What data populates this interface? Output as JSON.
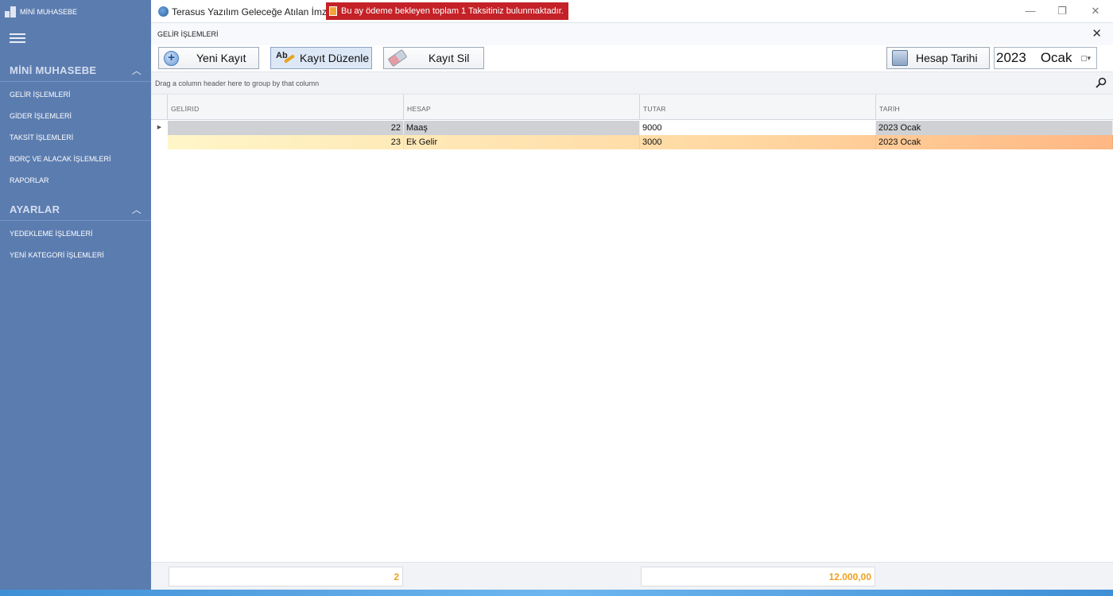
{
  "sidebar": {
    "app_title": "MİNİ MUHASEBE",
    "groups": [
      {
        "label": "MİNİ MUHASEBE",
        "items": [
          "GELİR İŞLEMLERİ",
          "GİDER İŞLEMLERİ",
          "TAKSİT İŞLEMLERİ",
          "BORÇ VE ALACAK İŞLEMLERİ",
          "RAPORLAR"
        ]
      },
      {
        "label": "AYARLAR",
        "items": [
          "YEDEKLEME İŞLEMLERİ",
          "YENİ KATEGORİ İŞLEMLERİ"
        ]
      }
    ]
  },
  "titlebar": {
    "title": "Terasus Yazılım Geleceğe Atılan İmza...",
    "alert": "Bu ay ödeme bekleyen toplam 1 Taksitiniz bulunmaktadır.",
    "minimize": "—",
    "restore": "❐",
    "close": "✕"
  },
  "panel": {
    "title": "GELİR İŞLEMLERİ",
    "close": "✕"
  },
  "toolbar": {
    "new_label": "Yeni Kayıt",
    "edit_label": "Kayıt Düzenle",
    "delete_label": "Kayıt Sil",
    "account_date_label": "Hesap Tarihi",
    "date_year": "2023",
    "date_month": "Ocak"
  },
  "grid": {
    "group_hint": "Drag a column header here to group by that column",
    "columns": [
      "GELİRID",
      "HESAP",
      "TUTAR",
      "TARİH"
    ],
    "rows": [
      {
        "id": "22",
        "hesap": "Maaş",
        "tutar": "9000",
        "tarih": "2023 Ocak"
      },
      {
        "id": "23",
        "hesap": "Ek Gelir",
        "tutar": "3000",
        "tarih": "2023 Ocak"
      }
    ],
    "footer_count": "2",
    "footer_total": "12.000,00"
  },
  "colors": {
    "sidebar_bg": "#5b7caf",
    "alert_bg": "#c42228",
    "footer_accent": "#f0a020"
  }
}
